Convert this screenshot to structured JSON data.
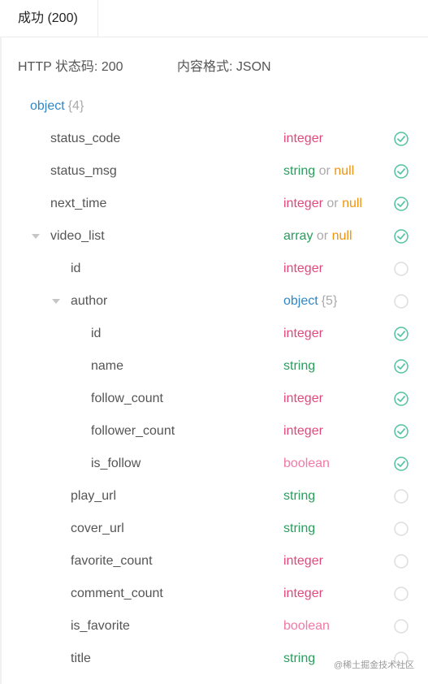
{
  "tab": {
    "label": "成功 (200)"
  },
  "meta": {
    "status_label": "HTTP 状态码: 200",
    "format_label": "内容格式: JSON"
  },
  "root": {
    "name": "object",
    "count": "{4}"
  },
  "fields": [
    {
      "name": "status_code",
      "depth": 1,
      "caret": false,
      "types": [
        "integer"
      ],
      "required": true
    },
    {
      "name": "status_msg",
      "depth": 1,
      "caret": false,
      "types": [
        "string",
        "null"
      ],
      "required": true
    },
    {
      "name": "next_time",
      "depth": 1,
      "caret": false,
      "types": [
        "integer",
        "null"
      ],
      "required": true
    },
    {
      "name": "video_list",
      "depth": 1,
      "caret": true,
      "types": [
        "array",
        "null"
      ],
      "required": true
    },
    {
      "name": "id",
      "depth": 2,
      "caret": false,
      "types": [
        "integer"
      ],
      "required": false
    },
    {
      "name": "author",
      "depth": 2,
      "caret": true,
      "types": [
        "object"
      ],
      "type_count": "{5}",
      "required": false
    },
    {
      "name": "id",
      "depth": 3,
      "caret": false,
      "types": [
        "integer"
      ],
      "required": true
    },
    {
      "name": "name",
      "depth": 3,
      "caret": false,
      "types": [
        "string"
      ],
      "required": true
    },
    {
      "name": "follow_count",
      "depth": 3,
      "caret": false,
      "types": [
        "integer"
      ],
      "required": true
    },
    {
      "name": "follower_count",
      "depth": 3,
      "caret": false,
      "types": [
        "integer"
      ],
      "required": true
    },
    {
      "name": "is_follow",
      "depth": 3,
      "caret": false,
      "types": [
        "boolean"
      ],
      "required": true
    },
    {
      "name": "play_url",
      "depth": 2,
      "caret": false,
      "types": [
        "string"
      ],
      "required": false
    },
    {
      "name": "cover_url",
      "depth": 2,
      "caret": false,
      "types": [
        "string"
      ],
      "required": false
    },
    {
      "name": "favorite_count",
      "depth": 2,
      "caret": false,
      "types": [
        "integer"
      ],
      "required": false
    },
    {
      "name": "comment_count",
      "depth": 2,
      "caret": false,
      "types": [
        "integer"
      ],
      "required": false
    },
    {
      "name": "is_favorite",
      "depth": 2,
      "caret": false,
      "types": [
        "boolean"
      ],
      "required": false
    },
    {
      "name": "title",
      "depth": 2,
      "caret": false,
      "types": [
        "string"
      ],
      "required": false
    }
  ],
  "or_word": "or",
  "watermark": "@稀土掘金技术社区",
  "colors": {
    "integer": "#e0487a",
    "string": "#2a9c5c",
    "boolean": "#f27aa5",
    "object": "#2f86c6",
    "null": "#f0940c",
    "check": "#4fc3a1",
    "unchecked": "#dddddd"
  }
}
